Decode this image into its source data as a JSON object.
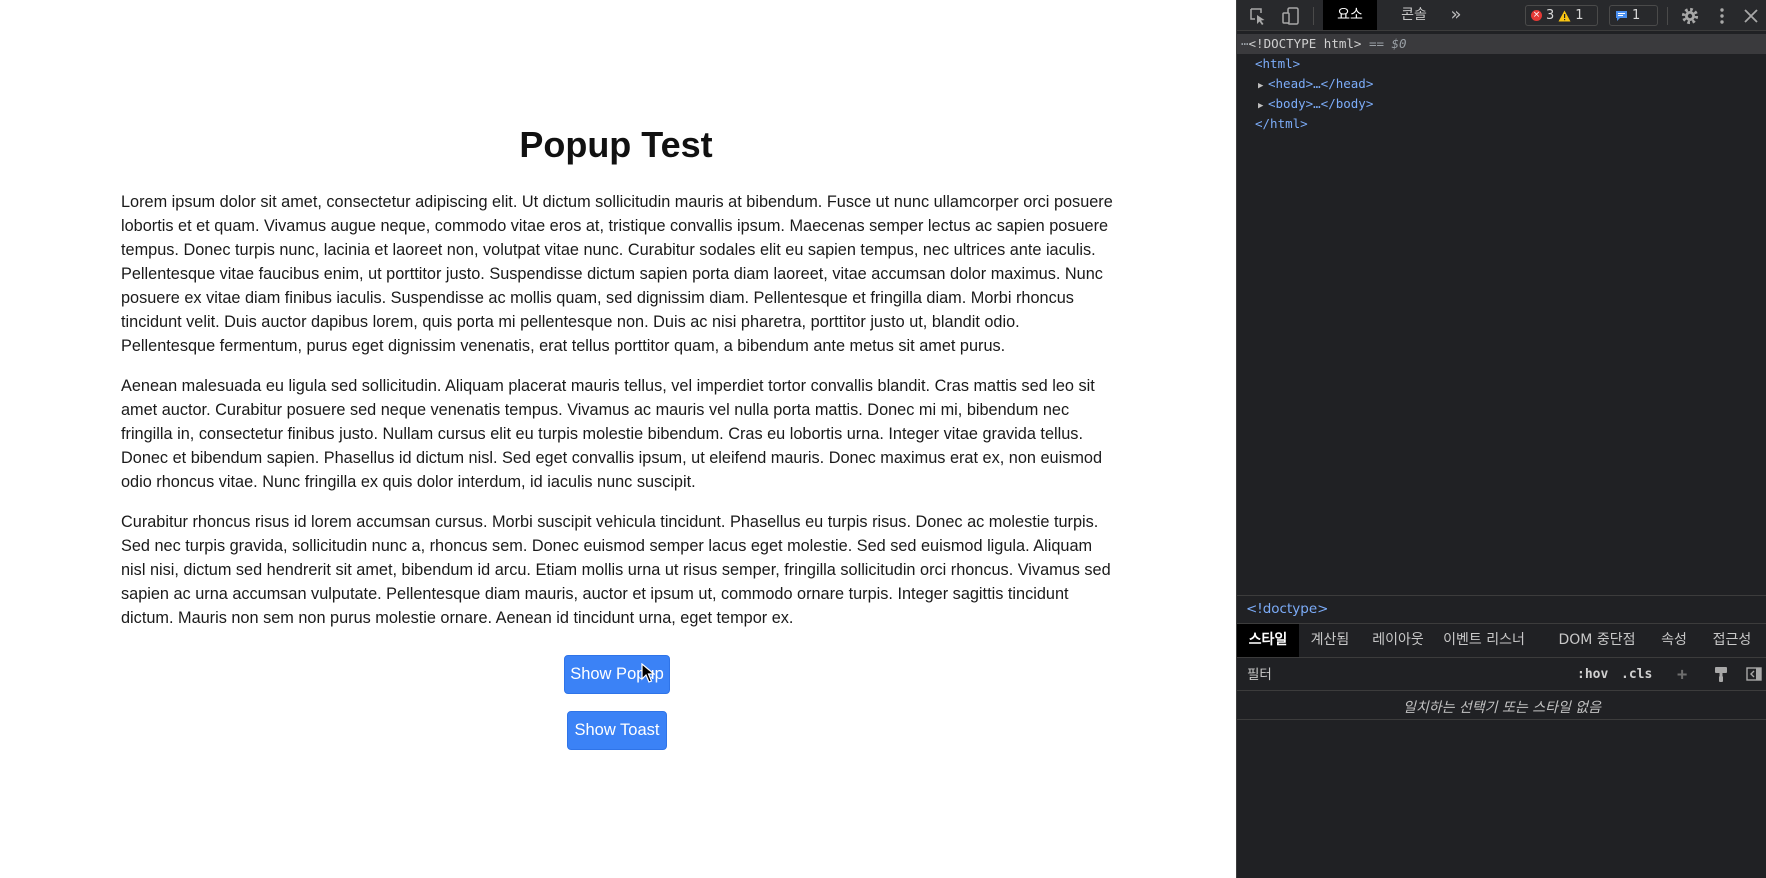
{
  "page": {
    "title": "Popup Test",
    "paragraphs": [
      "Lorem ipsum dolor sit amet, consectetur adipiscing elit. Ut dictum sollicitudin mauris at bibendum. Fusce ut nunc ullamcorper orci posuere lobortis et et quam. Vivamus augue neque, commodo vitae eros at, tristique convallis ipsum. Maecenas semper lectus ac sapien posuere tempus. Donec turpis nunc, lacinia et laoreet non, volutpat vitae nunc. Curabitur sodales elit eu sapien tempus, nec ultrices ante iaculis. Pellentesque vitae faucibus enim, ut porttitor justo. Suspendisse dictum sapien porta diam laoreet, vitae accumsan dolor maximus. Nunc posuere ex vitae diam finibus iaculis. Suspendisse ac mollis quam, sed dignissim diam. Pellentesque et fringilla diam. Morbi rhoncus tincidunt velit. Duis auctor dapibus lorem, quis porta mi pellentesque non. Duis ac nisi pharetra, porttitor justo ut, blandit odio. Pellentesque fermentum, purus eget dignissim venenatis, erat tellus porttitor quam, a bibendum ante metus sit amet purus.",
      "Aenean malesuada eu ligula sed sollicitudin. Aliquam placerat mauris tellus, vel imperdiet tortor convallis blandit. Cras mattis sed leo sit amet auctor. Curabitur posuere sed neque venenatis tempus. Vivamus ac mauris vel nulla porta mattis. Donec mi mi, bibendum nec fringilla in, consectetur finibus justo. Nullam cursus elit eu turpis molestie bibendum. Cras eu lobortis urna. Integer vitae gravida tellus. Donec et bibendum sapien. Phasellus id dictum nisl. Sed eget convallis ipsum, ut eleifend mauris. Donec maximus erat ex, non euismod odio rhoncus vitae. Nunc fringilla ex quis dolor interdum, id iaculis nunc suscipit.",
      "Curabitur rhoncus risus id lorem accumsan cursus. Morbi suscipit vehicula tincidunt. Phasellus eu turpis risus. Donec ac molestie turpis. Sed nec turpis gravida, sollicitudin nunc a, rhoncus sem. Donec euismod semper lacus eget molestie. Sed sed euismod ligula. Aliquam nisl nisi, dictum sed hendrerit sit amet, bibendum id arcu. Etiam mollis urna ut risus semper, fringilla sollicitudin orci rhoncus. Vivamus sed sapien ac urna accumsan vulputate. Pellentesque diam mauris, auctor et ipsum ut, commodo ornare turpis. Integer sagittis tincidunt dictum. Mauris non sem non purus molestie ornare. Aenean id tincidunt urna, eget tempor ex."
    ],
    "buttons": {
      "popup_label": "Show Popup",
      "toast_label": "Show Toast"
    },
    "colors": {
      "button_bg": "#3b82f6",
      "button_text": "#ffffff"
    }
  },
  "devtools": {
    "tabs": {
      "elements": "요소",
      "console": "콘솔",
      "more": "»"
    },
    "badges": {
      "errors": "3",
      "warnings": "1",
      "messages": "1"
    },
    "dom": {
      "doctype": "<!DOCTYPE html>",
      "doctype_suffix": "== $0",
      "html_open": "<html>",
      "head": "<head>…</head>",
      "body": "<body>…</body>",
      "html_close": "</html>"
    },
    "breadcrumb": "<!doctype>",
    "sub_tabs": [
      "스타일",
      "계산됨",
      "레이아웃",
      "이벤트 리스너",
      "DOM 중단점",
      "속성",
      "접근성"
    ],
    "filter": {
      "placeholder": "필터",
      "hov": ":hov",
      "cls": ".cls",
      "plus": "+"
    },
    "no_match_text": "일치하는 선택기 또는 스타일 없음",
    "colors": {
      "panel_bg": "#202124",
      "tag": "#7cacf8",
      "error": "#e53935",
      "warning": "#f9c513",
      "message": "#4a8ff0"
    },
    "icons": [
      "inspect-element-icon",
      "device-toolbar-icon",
      "settings-gear-icon",
      "kebab-menu-icon",
      "close-icon",
      "paint-brush-icon",
      "toggle-sidebar-icon"
    ]
  }
}
